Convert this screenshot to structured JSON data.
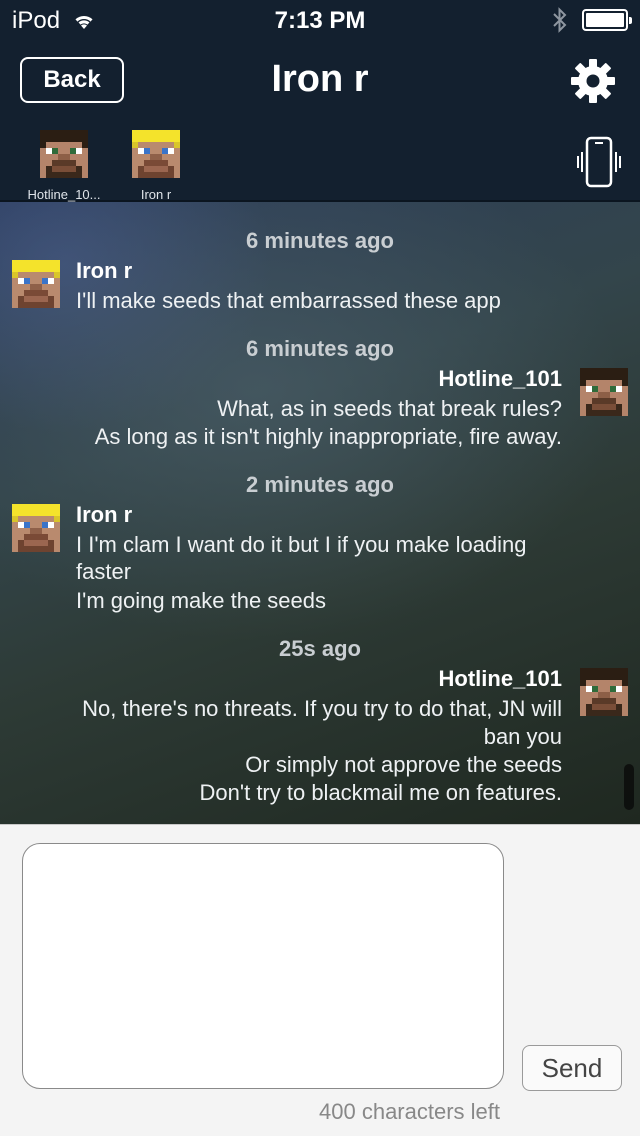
{
  "status_bar": {
    "carrier": "iPod",
    "time": "7:13 PM"
  },
  "nav": {
    "back_label": "Back",
    "title": "Iron r"
  },
  "participants": [
    {
      "name": "Hotline_10...",
      "avatar": "hotline-face"
    },
    {
      "name": "Iron r",
      "avatar": "iron-face"
    }
  ],
  "messages": [
    {
      "timestamp": "6 minutes ago",
      "sender": "Iron r",
      "side": "left",
      "lines": [
        "I'll make seeds that  embarrassed these app"
      ]
    },
    {
      "timestamp": "6 minutes ago",
      "sender": "Hotline_101",
      "side": "right",
      "lines": [
        "What, as in seeds that break rules?",
        "As long as it isn't highly inappropriate, fire away."
      ]
    },
    {
      "timestamp": "2 minutes ago",
      "sender": "Iron r",
      "side": "left",
      "lines": [
        "I I'm clam I want do it but I if you make loading",
        "faster",
        "I'm going make the seeds"
      ]
    },
    {
      "timestamp": "25s ago",
      "sender": "Hotline_101",
      "side": "right",
      "lines": [
        "No, there's no threats. If you try to do that, JN will",
        "ban you",
        "Or simply not approve the seeds",
        "Don't try to blackmail me on features."
      ]
    }
  ],
  "compose": {
    "input_value": "",
    "send_label": "Send",
    "chars_left": "400 characters left"
  },
  "colors": {
    "header_bg": "#13202f",
    "hair_dark": "#2a1d12",
    "hair_blond": "#f3e22a",
    "skin": "#b8876b"
  },
  "icons": [
    "wifi-icon",
    "bluetooth-icon",
    "battery-icon",
    "gear-icon",
    "vibrate-phone-icon"
  ]
}
